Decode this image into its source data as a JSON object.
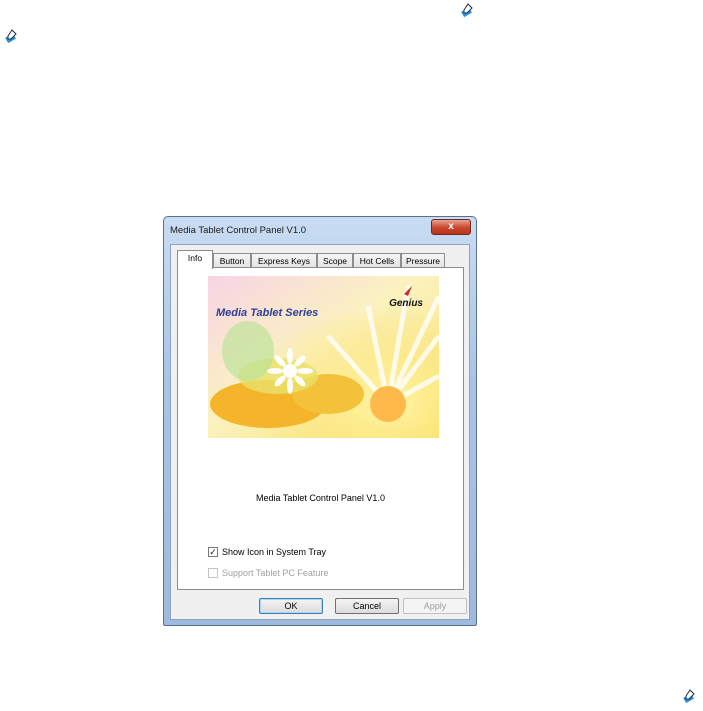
{
  "window": {
    "title": "Media Tablet Control Panel V1.0",
    "close_label": "x"
  },
  "tabs": [
    {
      "label": "Info"
    },
    {
      "label": "Button"
    },
    {
      "label": "Express Keys"
    },
    {
      "label": "Scope"
    },
    {
      "label": "Hot Cells"
    },
    {
      "label": "Pressure"
    }
  ],
  "banner": {
    "title": "Media Tablet Series",
    "brand": "Genius"
  },
  "info": {
    "app_name": "Media Tablet Control Panel V1.0",
    "show_icon_label": "Show Icon in System Tray",
    "show_icon_mark": "✓",
    "support_tablet_label": "Support Tablet PC Feature"
  },
  "buttons": {
    "ok": "OK",
    "cancel": "Cancel",
    "apply": "Apply"
  },
  "icons": [
    "tablet-pen-icon"
  ]
}
